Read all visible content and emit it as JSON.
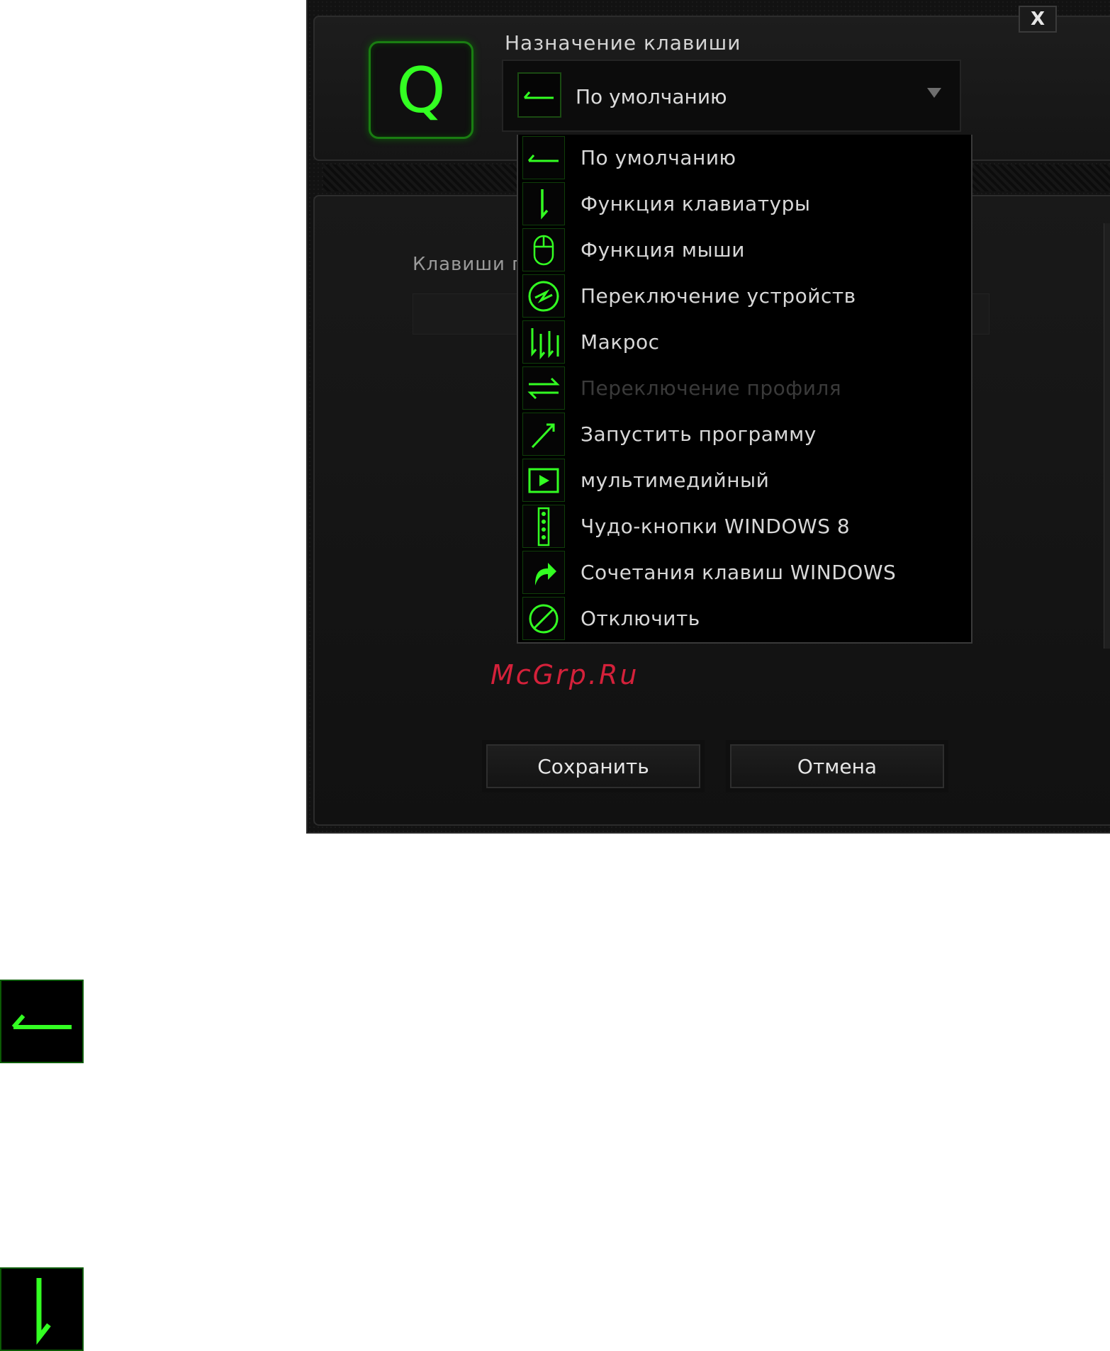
{
  "dialog": {
    "close_label": "X",
    "key_char": "Q",
    "assign_label": "Назначение клавиши",
    "selected_value": "По умолчанию",
    "keys_label_partial": "Клавиши п",
    "save_label": "Сохранить",
    "cancel_label": "Отмена"
  },
  "menu": {
    "items": [
      {
        "label": "По умолчанию",
        "icon": "default-arrow-icon",
        "enabled": true
      },
      {
        "label": "Функция клавиатуры",
        "icon": "keyboard-function-icon",
        "enabled": true
      },
      {
        "label": "Функция мыши",
        "icon": "mouse-icon",
        "enabled": true
      },
      {
        "label": "Переключение устройств",
        "icon": "device-switch-icon",
        "enabled": true
      },
      {
        "label": "Макрос",
        "icon": "macro-icon",
        "enabled": true
      },
      {
        "label": "Переключение профиля",
        "icon": "profile-switch-icon",
        "enabled": false
      },
      {
        "label": "Запустить программу",
        "icon": "launch-program-icon",
        "enabled": true
      },
      {
        "label": "мультимедийный",
        "icon": "multimedia-icon",
        "enabled": true
      },
      {
        "label": "Чудо-кнопки WINDOWS 8",
        "icon": "charms-icon",
        "enabled": true
      },
      {
        "label": "Сочетания клавиш WINDOWS",
        "icon": "shortcut-icon",
        "enabled": true
      },
      {
        "label": "Отключить",
        "icon": "disable-icon",
        "enabled": true
      }
    ]
  },
  "watermark": "McGrp.Ru",
  "colors": {
    "accent": "#33ff22",
    "dialog_bg": "#121212",
    "watermark": "#d4213a"
  }
}
